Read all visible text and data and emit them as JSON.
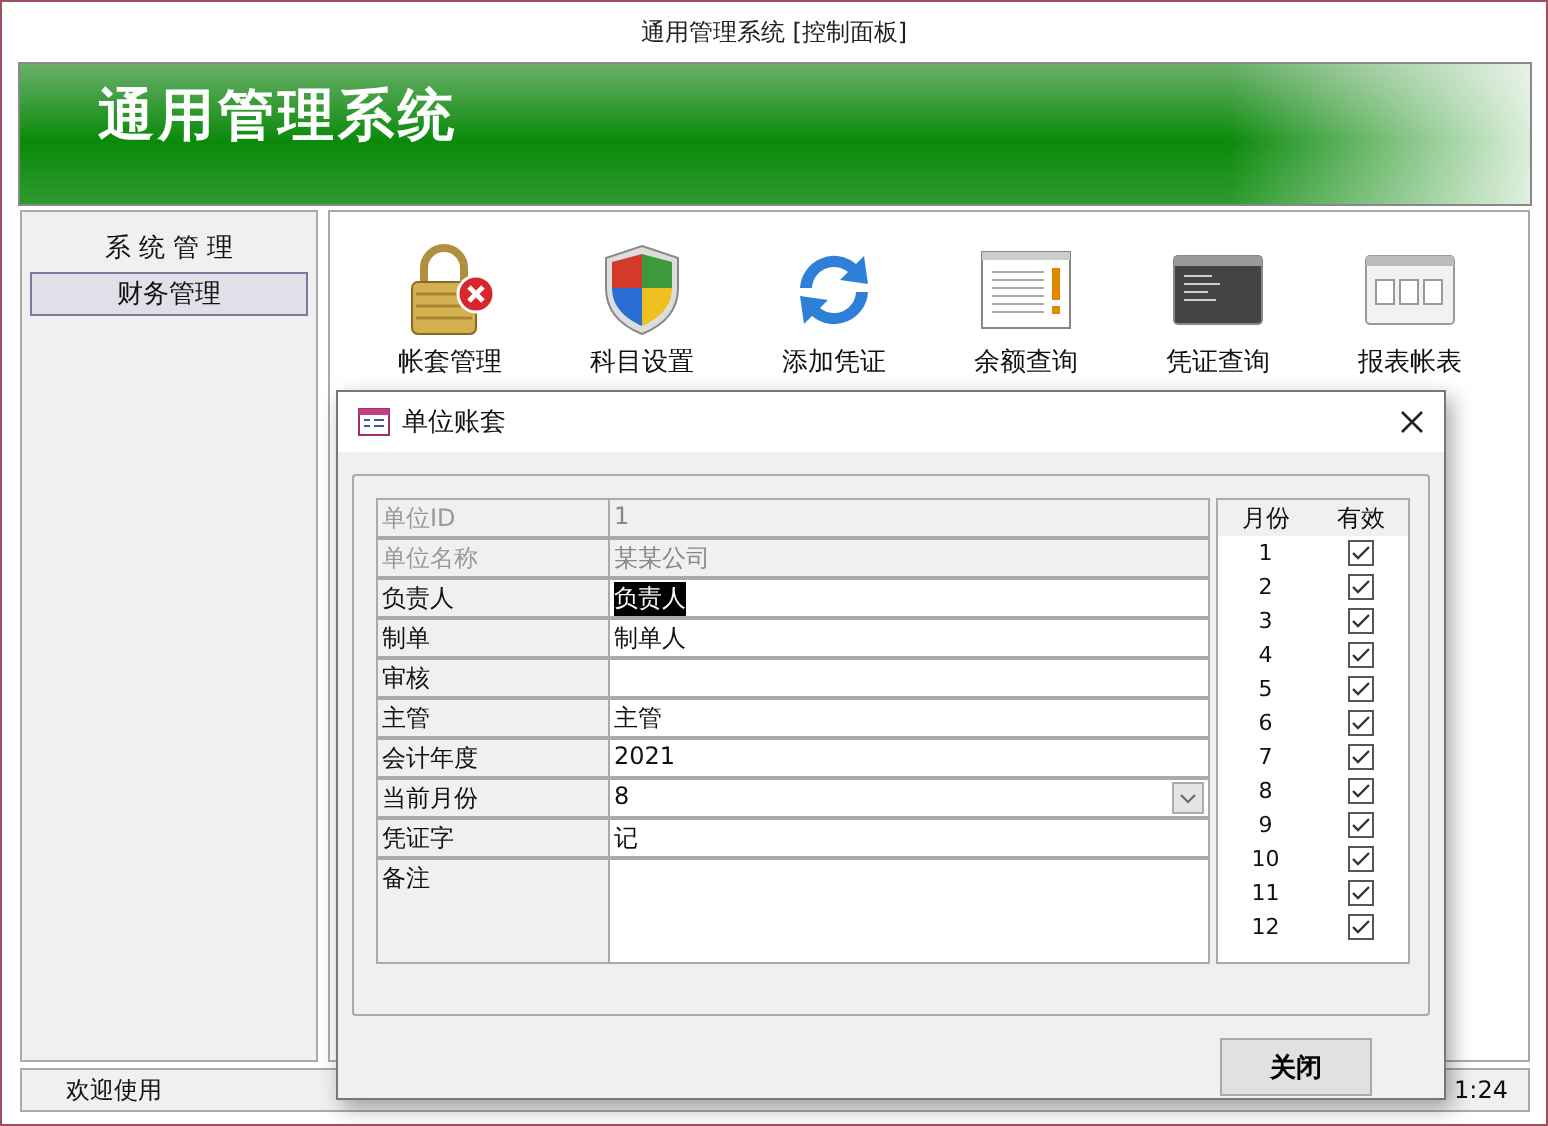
{
  "window": {
    "title": "通用管理系统 [控制面板]"
  },
  "banner": {
    "title": "通用管理系统"
  },
  "sidebar": {
    "items": [
      {
        "label": "系 统 管 理",
        "selected": false
      },
      {
        "label": "财务管理",
        "selected": true
      }
    ]
  },
  "toolbar": [
    {
      "label": "帐套管理",
      "kind": "lock"
    },
    {
      "label": "科目设置",
      "kind": "shield"
    },
    {
      "label": "添加凭证",
      "kind": "sync"
    },
    {
      "label": "余额查询",
      "kind": "notice"
    },
    {
      "label": "凭证查询",
      "kind": "console"
    },
    {
      "label": "报表帐表",
      "kind": "reports"
    }
  ],
  "status_bar": {
    "message": "欢迎使用",
    "time": "1:24"
  },
  "dialog": {
    "title": "单位账套",
    "fields": [
      {
        "label": "单位ID",
        "value": "1",
        "kind": "text",
        "disabled": true
      },
      {
        "label": "单位名称",
        "value": "某某公司",
        "kind": "text",
        "disabled": true
      },
      {
        "label": "负责人",
        "value": "负责人",
        "kind": "text",
        "disabled": false,
        "value_selected": true
      },
      {
        "label": "制单",
        "value": "制单人",
        "kind": "text",
        "disabled": false
      },
      {
        "label": "审核",
        "kind": "text",
        "disabled": false
      },
      {
        "label": "主管",
        "value": "主管",
        "kind": "text",
        "disabled": false
      },
      {
        "label": "会计年度",
        "value": "2021",
        "kind": "text",
        "disabled": false
      },
      {
        "label": "当前月份",
        "value": "8",
        "kind": "dropdown",
        "disabled": false
      },
      {
        "label": "凭证字",
        "value": "记",
        "kind": "text",
        "disabled": false
      },
      {
        "label": "备注",
        "kind": "memo",
        "disabled": false
      }
    ],
    "months": {
      "columns": [
        "月份",
        "有效"
      ],
      "rows": [
        {
          "month": "1",
          "valid": true
        },
        {
          "month": "2",
          "valid": true
        },
        {
          "month": "3",
          "valid": true
        },
        {
          "month": "4",
          "valid": true
        },
        {
          "month": "5",
          "valid": true
        },
        {
          "month": "6",
          "valid": true
        },
        {
          "month": "7",
          "valid": true
        },
        {
          "month": "8",
          "valid": true
        },
        {
          "month": "9",
          "valid": true
        },
        {
          "month": "10",
          "valid": true
        },
        {
          "month": "11",
          "valid": true
        },
        {
          "month": "12",
          "valid": true
        }
      ]
    },
    "close_button": "关闭"
  }
}
